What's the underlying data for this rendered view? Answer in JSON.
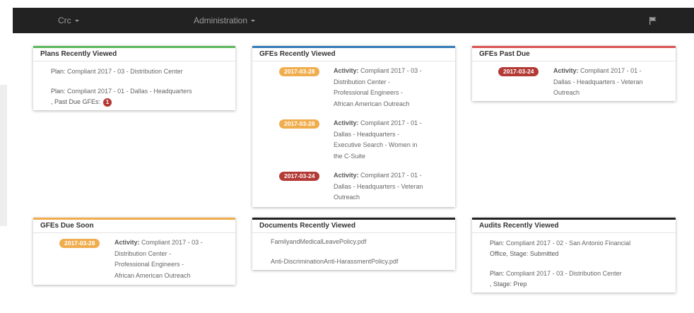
{
  "nav": {
    "crc": "Crc",
    "admin": "Administration"
  },
  "plans": {
    "title": "Plans Recently Viewed",
    "items": [
      {
        "label": "Plan:",
        "name": "Compliant 2017 - 03 - Distribution Center"
      },
      {
        "label": "Plan:",
        "name": "Compliant 2017 - 01 - Dallas - Headquarters",
        "suffix": ", Past Due GFEs:",
        "count": "1"
      }
    ]
  },
  "gfes_recent": {
    "title": "GFEs Recently Viewed",
    "items": [
      {
        "date": "2017-03-28",
        "label": "Activity:",
        "lines": [
          "Compliant 2017 - 03 -",
          "Distribution Center -",
          "Professional Engineers -",
          "African American Outreach"
        ]
      },
      {
        "date": "2017-03-28",
        "label": "Activity:",
        "lines": [
          "Compliant 2017 - 01 -",
          "Dallas - Headquarters -",
          "Executive Search - Women in",
          "the C-Suite"
        ]
      },
      {
        "date": "2017-03-24",
        "label": "Activity:",
        "lines": [
          "Compliant 2017 - 01 -",
          "Dallas - Headquarters - Veteran",
          "Outreach"
        ]
      }
    ]
  },
  "gfes_past": {
    "title": "GFEs Past Due",
    "items": [
      {
        "date": "2017-03-24",
        "label": "Activity:",
        "lines": [
          "Compliant 2017 - 01 -",
          "Dallas - Headquarters - Veteran",
          "Outreach"
        ]
      }
    ]
  },
  "gfes_soon": {
    "title": "GFEs Due Soon",
    "items": [
      {
        "date": "2017-03-28",
        "label": "Activity:",
        "lines": [
          "Compliant 2017 - 03 -",
          "Distribution Center -",
          "Professional Engineers -",
          "African American Outreach"
        ]
      }
    ]
  },
  "docs": {
    "title": "Documents Recently Viewed",
    "items": [
      "FamilyandMedicalLeavePolicy.pdf",
      "Anti-DiscriminationAnti-HarassmentPolicy.pdf"
    ]
  },
  "audits": {
    "title": "Audits Recently Viewed",
    "items": [
      {
        "label": "Plan:",
        "line1": "Compliant 2017 - 02 - San Antonio Financial",
        "line2": "Office",
        "stage_label": ", Stage:",
        "stage": "Submitted"
      },
      {
        "label": "Plan:",
        "line1": "Compliant 2017 - 03 - Distribution Center",
        "line2": "",
        "stage_label": ", Stage:",
        "stage": "Prep"
      }
    ]
  },
  "colors": {
    "navbar": "#222222",
    "green": "#5cb85c",
    "blue": "#337ab7",
    "red": "#d9534f",
    "orange": "#f0ad4e",
    "badge_red": "#b33a35"
  }
}
